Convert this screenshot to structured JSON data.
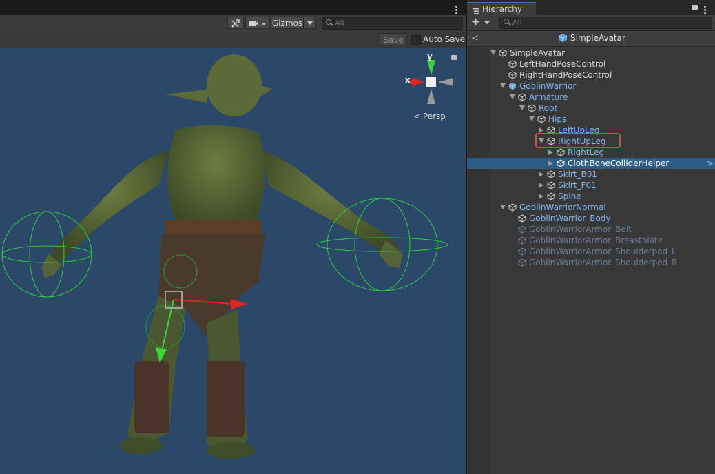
{
  "scene": {
    "gizmos_label": "Gizmos",
    "search_placeholder": "All",
    "save_label": "Save",
    "autosave_label": "Auto Save",
    "axis_y": "y",
    "axis_x": "x",
    "persp_label": "Persp"
  },
  "hierarchy": {
    "tab_label": "Hierarchy",
    "add_label": "+",
    "search_placeholder": "All",
    "root_title": "SimpleAvatar",
    "rows": [
      {
        "label": "SimpleAvatar",
        "color": "white",
        "prefab": false
      },
      {
        "label": "LeftHandPoseControl",
        "color": "white",
        "prefab": false
      },
      {
        "label": "RightHandPoseControl",
        "color": "white",
        "prefab": false
      },
      {
        "label": "GoblinWarrior",
        "color": "blue",
        "prefab": true
      },
      {
        "label": "Armature",
        "color": "blue",
        "prefab": false
      },
      {
        "label": "Root",
        "color": "blue",
        "prefab": false
      },
      {
        "label": "Hips",
        "color": "blue",
        "prefab": false
      },
      {
        "label": "LeftUpLeg",
        "color": "blue",
        "prefab": false
      },
      {
        "label": "RightUpLeg",
        "color": "blue",
        "prefab": false
      },
      {
        "label": "RightLeg",
        "color": "blue",
        "prefab": false
      },
      {
        "label": "ClothBoneColliderHelper",
        "color": "white",
        "prefab": false
      },
      {
        "label": "Skirt_B01",
        "color": "blue",
        "prefab": false
      },
      {
        "label": "Skirt_F01",
        "color": "blue",
        "prefab": false
      },
      {
        "label": "Spine",
        "color": "blue",
        "prefab": false
      },
      {
        "label": "GoblinWarriorNormal",
        "color": "blue",
        "prefab": false
      },
      {
        "label": "GoblinWarrior_Body",
        "color": "blue",
        "prefab": false
      },
      {
        "label": "GoblinWarriorArmor_Belt",
        "color": "dim",
        "prefab": false
      },
      {
        "label": "GoblinWarriorArmor_Breastplate",
        "color": "dim",
        "prefab": false
      },
      {
        "label": "GoblinWarriorArmor_Shoulderpad_L",
        "color": "dim",
        "prefab": false
      },
      {
        "label": "GoblinWarriorArmor_Shoulderpad_R",
        "color": "dim",
        "prefab": false
      }
    ],
    "selected_row": "ClothBoneColliderHelper",
    "highlighted_row": "RightUpLeg"
  },
  "colors": {
    "viewport_bg": "#2c4868",
    "selection": "#2c5d87",
    "highlight_box": "#e04848",
    "prefab_text": "#7fb3f3"
  }
}
